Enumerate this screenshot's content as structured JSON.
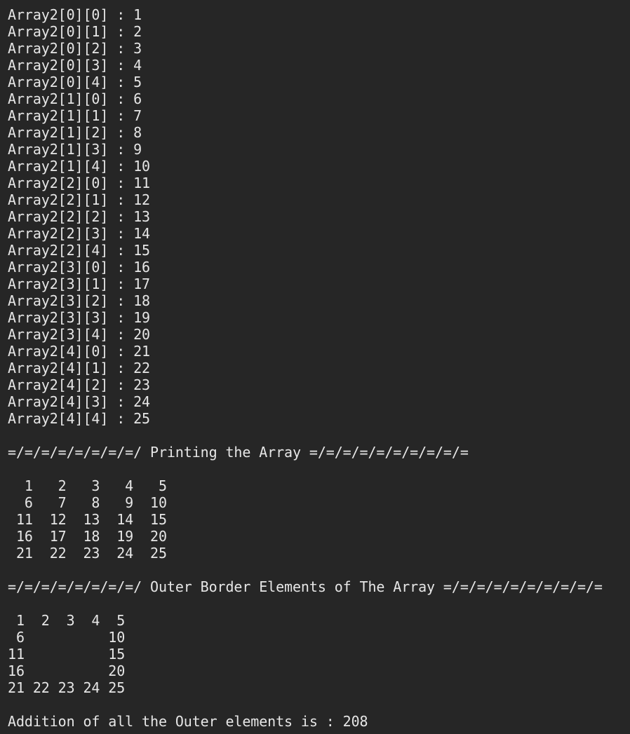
{
  "terminal": {
    "background": "#262626",
    "foreground": "#e6e6e6",
    "lines": [
      "Array2[0][0] : 1",
      "Array2[0][1] : 2",
      "Array2[0][2] : 3",
      "Array2[0][3] : 4",
      "Array2[0][4] : 5",
      "Array2[1][0] : 6",
      "Array2[1][1] : 7",
      "Array2[1][2] : 8",
      "Array2[1][3] : 9",
      "Array2[1][4] : 10",
      "Array2[2][0] : 11",
      "Array2[2][1] : 12",
      "Array2[2][2] : 13",
      "Array2[2][3] : 14",
      "Array2[2][4] : 15",
      "Array2[3][0] : 16",
      "Array2[3][1] : 17",
      "Array2[3][2] : 18",
      "Array2[3][3] : 19",
      "Array2[3][4] : 20",
      "Array2[4][0] : 21",
      "Array2[4][1] : 22",
      "Array2[4][2] : 23",
      "Array2[4][3] : 24",
      "Array2[4][4] : 25",
      "",
      "=/=/=/=/=/=/=/=/ Printing the Array =/=/=/=/=/=/=/=/=/=",
      "",
      "  1   2   3   4   5",
      "  6   7   8   9  10",
      " 11  12  13  14  15",
      " 16  17  18  19  20",
      " 21  22  23  24  25",
      "",
      "=/=/=/=/=/=/=/=/ Outer Border Elements of The Array =/=/=/=/=/=/=/=/=/=",
      "",
      " 1  2  3  4  5",
      " 6          10",
      "11          15",
      "16          20",
      "21 22 23 24 25",
      "",
      "Addition of all the Outer elements is : 208"
    ]
  }
}
